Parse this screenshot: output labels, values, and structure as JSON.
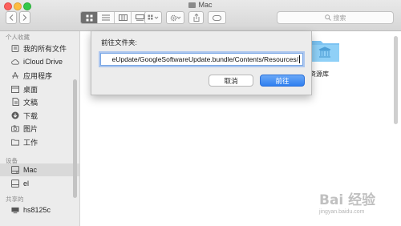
{
  "window": {
    "title": "Mac"
  },
  "toolbar": {
    "back_icon": "chevron-left-icon",
    "forward_icon": "chevron-right-icon",
    "view_icons": [
      "grid-view-icon",
      "list-view-icon",
      "column-view-icon",
      "gallery-view-icon"
    ],
    "search_placeholder": "搜索"
  },
  "sidebar": {
    "favorites_header": "个人收藏",
    "favorites": [
      {
        "label": "我的所有文件",
        "icon": "all-files-icon"
      },
      {
        "label": "iCloud Drive",
        "icon": "cloud-icon"
      },
      {
        "label": "应用程序",
        "icon": "applications-icon"
      },
      {
        "label": "桌面",
        "icon": "desktop-icon"
      },
      {
        "label": "文稿",
        "icon": "documents-icon"
      },
      {
        "label": "下载",
        "icon": "downloads-icon"
      },
      {
        "label": "图片",
        "icon": "pictures-icon"
      },
      {
        "label": "工作",
        "icon": "folder-icon"
      }
    ],
    "devices_header": "设备",
    "devices": [
      {
        "label": "Mac",
        "icon": "computer-icon",
        "selected": true
      },
      {
        "label": "el",
        "icon": "disk-icon",
        "selected": false
      }
    ],
    "shared_header": "共享的",
    "shared": [
      {
        "label": "hs8125c",
        "icon": "network-computer-icon"
      }
    ]
  },
  "main": {
    "folder_label": "资源库",
    "folder_icon": "library-folder-icon"
  },
  "dialog": {
    "label": "前往文件夹:",
    "path_value": "eUpdate/GoogleSoftwareUpdate.bundle/Contents/Resources/",
    "cancel_label": "取消",
    "go_label": "前往"
  },
  "watermark": {
    "brand": "Bai 经验",
    "url": "jingyan.baidu.com"
  },
  "colors": {
    "accent": "#2f7ff0",
    "folder_blue": "#7cc3f2"
  }
}
